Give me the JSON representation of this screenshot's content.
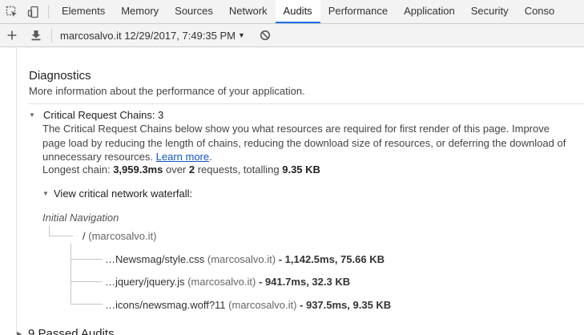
{
  "tabs": [
    {
      "label": "Elements",
      "active": false
    },
    {
      "label": "Memory",
      "active": false
    },
    {
      "label": "Sources",
      "active": false
    },
    {
      "label": "Network",
      "active": false
    },
    {
      "label": "Audits",
      "active": true
    },
    {
      "label": "Performance",
      "active": false
    },
    {
      "label": "Application",
      "active": false
    },
    {
      "label": "Security",
      "active": false
    },
    {
      "label": "Conso",
      "active": false
    }
  ],
  "toolbar": {
    "report_label": "marcosalvo.it 12/29/2017, 7:49:35 PM"
  },
  "diagnostics": {
    "title": "Diagnostics",
    "description": "More information about the performance of your application."
  },
  "critical_chains": {
    "heading": "Critical Request Chains: 3",
    "description": "The Critical Request Chains below show you what resources are required for first render of this page. Improve page load by reducing the length of chains, reducing the download size of resources, or deferring the download of unnecessary resources. ",
    "learn_more": "Learn more",
    "period": ".",
    "longest_prefix": "Longest chain: ",
    "longest_time": "3,959.3ms",
    "longest_over": " over ",
    "longest_count": "2",
    "longest_requests": " requests, totalling ",
    "longest_size": "9.35 KB",
    "waterfall_label": "View critical network waterfall:",
    "initial_navigation": "Initial Navigation",
    "root": {
      "url": "/",
      "host": " (marcosalvo.it)"
    },
    "children": [
      {
        "url": "…Newsmag/style.css",
        "host": " (marcosalvo.it)",
        "stats": " - 1,142.5ms, 75.66 KB"
      },
      {
        "url": "…jquery/jquery.js",
        "host": " (marcosalvo.it)",
        "stats": " - 941.7ms, 32.3 KB"
      },
      {
        "url": "…icons/newsmag.woff?11",
        "host": " (marcosalvo.it)",
        "stats": " - 937.5ms, 9.35 KB"
      }
    ]
  },
  "passed_audits": "9 Passed Audits"
}
